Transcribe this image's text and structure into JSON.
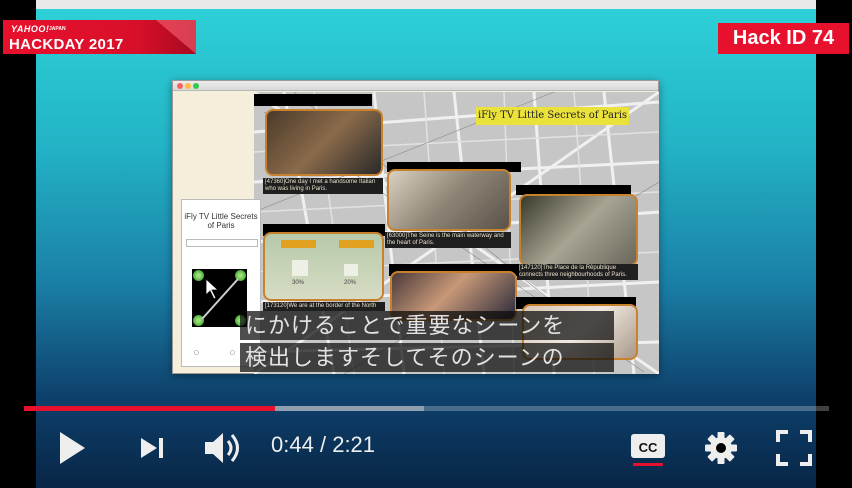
{
  "player": {
    "current_time": "0:44",
    "separator": "/",
    "duration": "2:21",
    "played_fraction": 0.312,
    "buffered_fraction": 0.497,
    "captions_on": true,
    "accent_color": "#e8112d"
  },
  "overlays": {
    "hackday_logo": "YAHOO! JAPAN HACKDAY 2017",
    "hack_id": "Hack ID 74"
  },
  "subtitles": {
    "line1": "にかけることで重要なシーンを",
    "line2": "検出しますそしてそのシーンの"
  },
  "slide": {
    "app_panel_title": "iFly TV Little Secrets of Paris",
    "map_title": "iFly TV Little Secrets of Paris",
    "captions": [
      "[47360]One day I met a handsome Italian who was living in Paris.",
      "[63000]The Seine is the main waterway and the heart of Paris.",
      "[147120]The Place de la Rêpublique connects three neighbourhoods of Paris.",
      "[173120]We are at the border of the North"
    ],
    "percent_labels": [
      "30%",
      "20%"
    ]
  },
  "icons": {
    "play": "play-icon",
    "next": "next-icon",
    "volume": "volume-icon",
    "captions": "cc-icon",
    "settings": "gear-icon",
    "fullscreen": "fullscreen-icon"
  }
}
